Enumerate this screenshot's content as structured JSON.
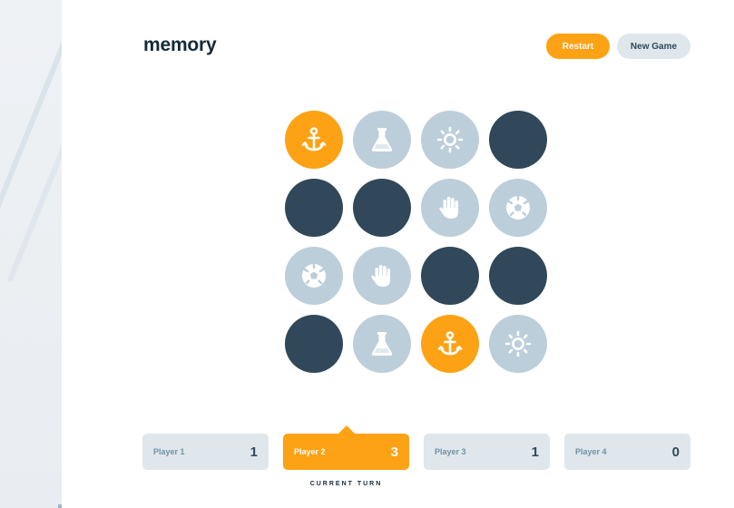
{
  "app": {
    "title": "memory"
  },
  "header": {
    "restart_label": "Restart",
    "new_game_label": "New Game"
  },
  "board": {
    "size": 4,
    "tiles": [
      {
        "state": "matched",
        "icon": "anchor-icon"
      },
      {
        "state": "revealed",
        "icon": "flask-icon"
      },
      {
        "state": "revealed",
        "icon": "sun-icon"
      },
      {
        "state": "hidden",
        "icon": ""
      },
      {
        "state": "hidden",
        "icon": ""
      },
      {
        "state": "hidden",
        "icon": ""
      },
      {
        "state": "revealed",
        "icon": "hand-icon"
      },
      {
        "state": "revealed",
        "icon": "soccer-ball-icon"
      },
      {
        "state": "revealed",
        "icon": "soccer-ball-icon"
      },
      {
        "state": "revealed",
        "icon": "hand-icon"
      },
      {
        "state": "hidden",
        "icon": ""
      },
      {
        "state": "hidden",
        "icon": ""
      },
      {
        "state": "hidden",
        "icon": ""
      },
      {
        "state": "revealed",
        "icon": "flask-icon"
      },
      {
        "state": "matched",
        "icon": "anchor-icon"
      },
      {
        "state": "revealed",
        "icon": "sun-icon"
      }
    ]
  },
  "players": [
    {
      "name": "Player 1",
      "score": "1",
      "active": false
    },
    {
      "name": "Player 2",
      "score": "3",
      "active": true
    },
    {
      "name": "Player 3",
      "score": "1",
      "active": false
    },
    {
      "name": "Player 4",
      "score": "0",
      "active": false
    }
  ],
  "turn_label": "CURRENT TURN",
  "colors": {
    "accent": "#fda214",
    "hidden": "#304859",
    "revealed": "#bcced9",
    "text": "#152938",
    "muted": "#dfe7ec"
  }
}
